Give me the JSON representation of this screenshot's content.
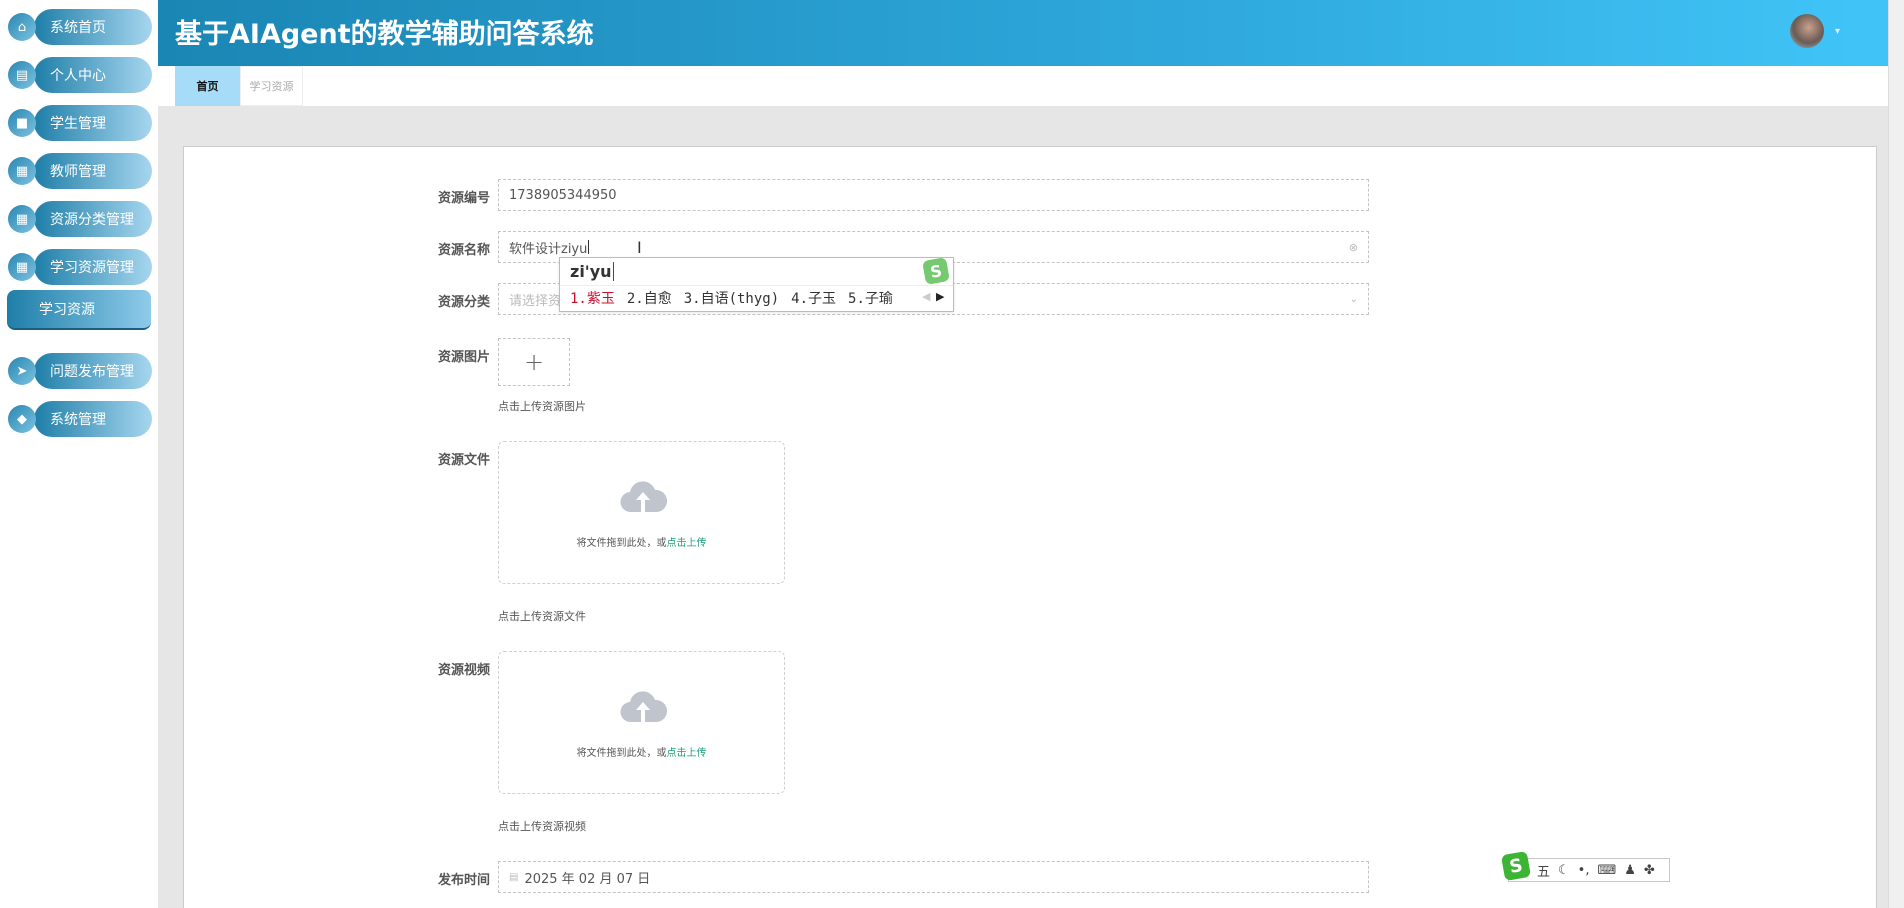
{
  "sidebar": {
    "items": [
      {
        "label": "系统首页",
        "icon": "home-icon"
      },
      {
        "label": "个人中心",
        "icon": "profile-icon"
      },
      {
        "label": "学生管理",
        "icon": "briefcase-icon"
      },
      {
        "label": "教师管理",
        "icon": "grid-icon"
      },
      {
        "label": "资源分类管理",
        "icon": "grid-icon"
      },
      {
        "label": "学习资源管理",
        "icon": "grid-icon"
      },
      {
        "label": "问题发布管理",
        "icon": "send-icon"
      },
      {
        "label": "系统管理",
        "icon": "settings-icon"
      }
    ],
    "active_sub": "学习资源"
  },
  "header": {
    "title": "基于AIAgent的教学辅助问答系统",
    "caret": "▾"
  },
  "tabs": [
    {
      "label": "首页"
    },
    {
      "label": "学习资源"
    }
  ],
  "form": {
    "id_label": "资源编号",
    "id_value": "1738905344950",
    "name_label": "资源名称",
    "name_value": "软件设计ziyu",
    "category_label": "资源分类",
    "category_placeholder": "请选择资",
    "image_label": "资源图片",
    "image_caption": "点击上传资源图片",
    "file_label": "资源文件",
    "file_drop_text": "将文件拖到此处，或",
    "file_drop_link": "点击上传",
    "file_caption": "点击上传资源文件",
    "video_label": "资源视频",
    "video_drop_text": "将文件拖到此处，或",
    "video_drop_link": "点击上传",
    "video_caption": "点击上传资源视频",
    "date_label": "发布时间",
    "date_value": "2025 年 02 月 07 日"
  },
  "ime": {
    "composition": "zi'yu",
    "candidates": [
      "1.紫玉",
      "2.自愈",
      "3.自语(thyg)",
      "4.子玉",
      "5.子瑜"
    ],
    "toolbar_mode": "五",
    "logo": "S"
  },
  "colors": {
    "header_start": "#1a86b4",
    "header_end": "#41c5f8",
    "active_tab": "#a6dcf7",
    "link": "#17a07a",
    "ime_first": "#c8102e"
  }
}
